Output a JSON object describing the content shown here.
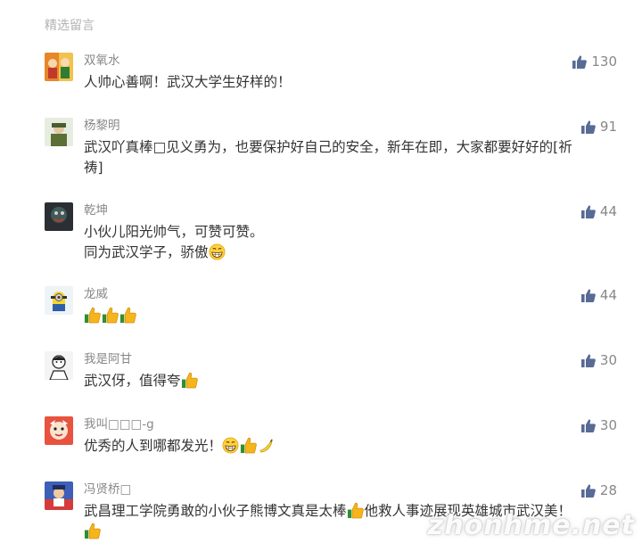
{
  "section_title": "精选留言",
  "like_icon": "thumbs-up-icon",
  "accent_color": "#576b95",
  "comments": [
    {
      "nickname": "双氧水",
      "likes": "130",
      "lines": [
        "人帅心善啊！武汉大学生好样的！"
      ]
    },
    {
      "nickname": "杨黎明",
      "likes": "91",
      "lines": [
        "武汉吖真棒□见义勇为，也要保护好自己的安全，新年在即，大家都要好好的[祈",
        "祷]"
      ]
    },
    {
      "nickname": "乾坤",
      "likes": "44",
      "lines": [
        "小伙儿阳光帅气，可赞可赞。",
        "同为武汉学子，骄傲"
      ]
    },
    {
      "nickname": "龙威",
      "likes": "44",
      "lines": [
        ""
      ]
    },
    {
      "nickname": "我是阿甘",
      "likes": "30",
      "lines": [
        "武汉伢，值得夸"
      ]
    },
    {
      "nickname": "我叫□□□-g",
      "likes": "30",
      "lines": [
        "优秀的人到哪都发光！"
      ]
    },
    {
      "nickname": "冯贤桥□",
      "likes": "28",
      "lines": [
        "武昌理工学院勇敢的小伙子熊博文真是太棒",
        "他救人事迹展现英雄城市武汉美！"
      ]
    }
  ],
  "watermark": "zhonhme.net"
}
